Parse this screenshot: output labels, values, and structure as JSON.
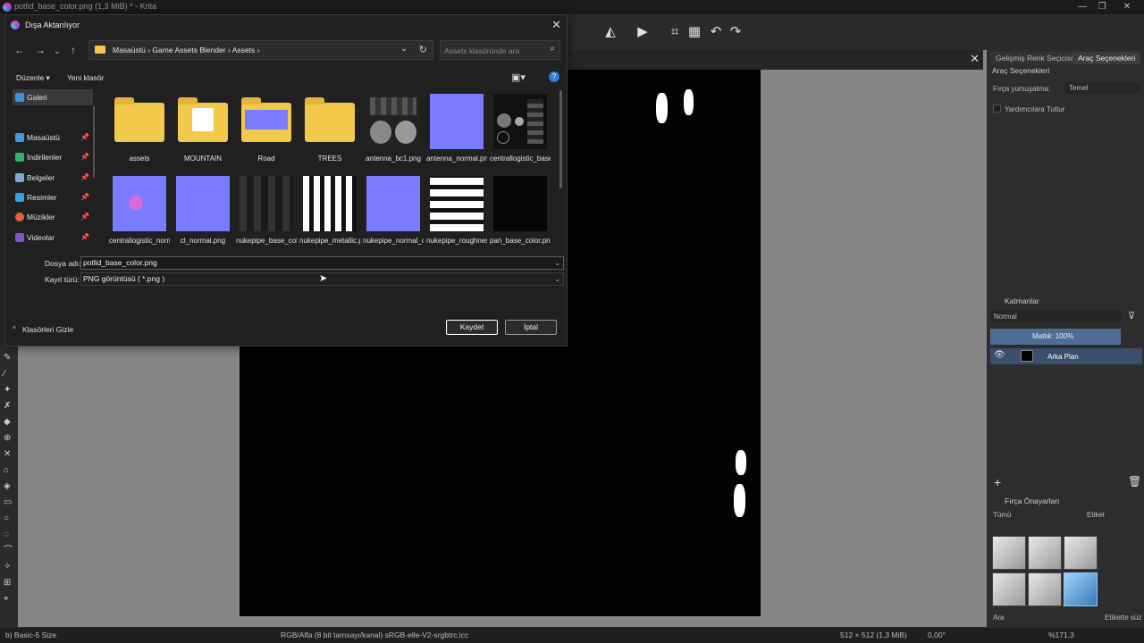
{
  "app": {
    "title": "potlid_base_color.png (1,3 MiB) * - Krita"
  },
  "right_docker": {
    "tabs": [
      "Gelişmiş Renk Seçicisi",
      "Araç Seçenekleri"
    ],
    "tool_options_title": "Araç Seçenekleri",
    "brush_smoothing_label": "Fırça yumuşatma:",
    "brush_smoothing_value": "Temel",
    "assistants_label": "Yardımcılara Tuttur",
    "layers_title": "Katmanlar",
    "blend_mode": "Normal",
    "opacity_label": "Matlık:  100%",
    "layer_name": "Arka Plan",
    "presets_title": "Fırça Önayarları",
    "presets_filter": "Tümü",
    "presets_tag": "Etiket",
    "presets_search_placeholder": "Ara",
    "presets_tag_filter": "Etikette süz"
  },
  "statusbar": {
    "brush": "b) Basic-5 Size",
    "color_info": "RGB/Alfa (8 bit tamsayı/kanal)  sRGB-elle-V2-srgbtrc.icc",
    "size": "512 × 512 (1,3 MiB)",
    "rotation": "0,00°",
    "zoom": "%171,3"
  },
  "dialog": {
    "title": "Dışa Aktarılıyor",
    "breadcrumbs": "Masaüstü  ›  Game Assets Blender  ›  Assets  ›",
    "search_placeholder": "Assets klasöründe ara",
    "organize": "Düzenle ▾",
    "new_folder": "Yeni klasör",
    "nav": [
      {
        "label": "Galeri",
        "color": "#3a8ee6",
        "pinned": false
      },
      {
        "label": "Masaüstü",
        "color": "#3a9be6",
        "pinned": true
      },
      {
        "label": "İndirilenler",
        "color": "#2fb06e",
        "pinned": true
      },
      {
        "label": "Belgeler",
        "color": "#7fa8d8",
        "pinned": true
      },
      {
        "label": "Resimler",
        "color": "#3aa0e6",
        "pinned": true
      },
      {
        "label": "Müzikler",
        "color": "#e6603a",
        "pinned": true
      },
      {
        "label": "Videolar",
        "color": "#8a4fd8",
        "pinned": true
      }
    ],
    "files": [
      "assets",
      "MOUNTAIN",
      "Road",
      "TREES",
      "antenna_bc1.png",
      "antenna_normal.png",
      "centrallogistic_base_color.png",
      "centrallogistic_normal.png",
      "cl_normal.png",
      "nukepipe_base_color.png",
      "nukepipe_metallic.png",
      "nukepipe_normal_opengl.png",
      "nukepipe_roughness.png",
      "pan_base_color.png"
    ],
    "filename_label": "Dosya adı:",
    "filename_value": "potlid_base_color.png",
    "filetype_label": "Kayıt türü:",
    "filetype_value": "PNG görüntüsü ( *.png )",
    "save_button": "Kaydet",
    "cancel_button": "İptal",
    "hide_folders": "Klasörleri Gizle"
  },
  "colors": {
    "accent": "#3a4f6e",
    "normal_map": "#7b7bff",
    "folder": "#f3c94c"
  }
}
